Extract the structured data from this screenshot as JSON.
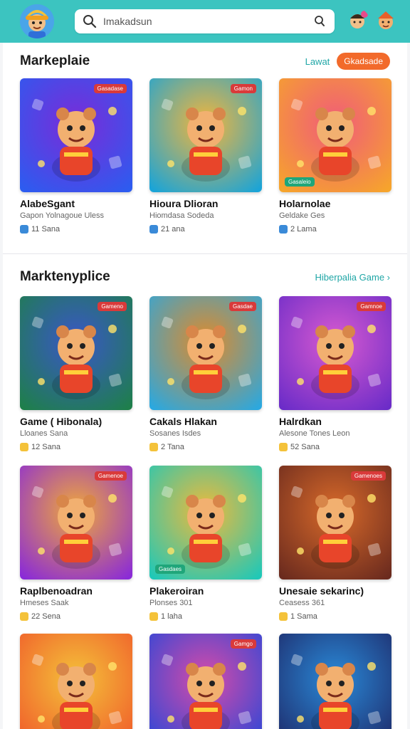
{
  "search": {
    "value": "Imakadsun",
    "placeholder": "Imakadsun"
  },
  "section1": {
    "title": "Markeplaie",
    "link": "Lawat",
    "button": "Gkadsade",
    "cards": [
      {
        "name": "AlabeSgant",
        "sub": "Gapon Yolnagoue Uless",
        "meta": "11 Sana",
        "tag": "Gasadase",
        "tag_color": "#d93a3a",
        "c1": "#2c5cf0",
        "c2": "#7a2bd8"
      },
      {
        "name": "Hioura Dlioran",
        "sub": "Hiomdasa Sodeda",
        "meta": "21 ana",
        "tag": "Gamon",
        "tag_color": "#d93a3a",
        "c1": "#19a4d8",
        "c2": "#f4b53a"
      },
      {
        "name": "Holarnolae",
        "sub": "Geldake Ges",
        "meta": "2 Lama",
        "tag": "Gasaleio",
        "tag_color": "#1fa67a",
        "c1": "#f6a52b",
        "c2": "#f05b7a"
      }
    ]
  },
  "section2": {
    "title": "Marktenyplice",
    "link": "Hiberpalia Game ›",
    "cards": [
      {
        "name": "Game ( Hibonala)",
        "sub": "Lloanes Sana",
        "meta": "12 Sana",
        "tag": "Gameno",
        "tag_color": "#d93a3a",
        "c1": "#1e7f4a",
        "c2": "#3a56c8"
      },
      {
        "name": "Cakals Hlakan",
        "sub": "Sosanes Isdes",
        "meta": "2 Tana",
        "tag": "Gasdae",
        "tag_color": "#d93a3a",
        "c1": "#2aa8e0",
        "c2": "#e08a2a"
      },
      {
        "name": "Halrdkan",
        "sub": "Alesone Tones Leon",
        "meta": "52 Sana",
        "tag": "Gamnoe",
        "tag_color": "#d93a3a",
        "c1": "#6b2cc8",
        "c2": "#d85ad0"
      }
    ]
  },
  "section3": {
    "cards": [
      {
        "name": "Raplbenoadran",
        "sub": "Hmeses Saak",
        "meta": "22 Sena",
        "tag": "Gamenoe",
        "tag_color": "#d93a3a",
        "c1": "#8a2ad8",
        "c2": "#f0a83a"
      },
      {
        "name": "Plakeroiran",
        "sub": "Plonses 301",
        "meta": "1 laha",
        "tag": "Gasdaes",
        "tag_color": "#1fa67a",
        "c1": "#1ec8b8",
        "c2": "#f0b93a"
      },
      {
        "name": "Unesaie sekarinc)",
        "sub": "Ceasess 361",
        "meta": "1 Sama",
        "tag": "Gamenoes",
        "tag_color": "#d93a3a",
        "c1": "#6a2a1e",
        "c2": "#d86a2a"
      }
    ]
  },
  "section4": {
    "cards": [
      {
        "tag": "",
        "c1": "#f05a2a",
        "c2": "#f4c23a"
      },
      {
        "tag": "Gamgo",
        "tag_color": "#d93a3a",
        "c1": "#2a48d8",
        "c2": "#d84aa8"
      },
      {
        "tag": "",
        "c1": "#1e2a6a",
        "c2": "#2a8ad8"
      }
    ]
  },
  "colors": {
    "topbar": "#3cc4c0",
    "accent": "#1fa6a6",
    "button": "#f26a2b"
  },
  "icons": {
    "search": "magnifier-icon",
    "meta": "star-icon"
  }
}
